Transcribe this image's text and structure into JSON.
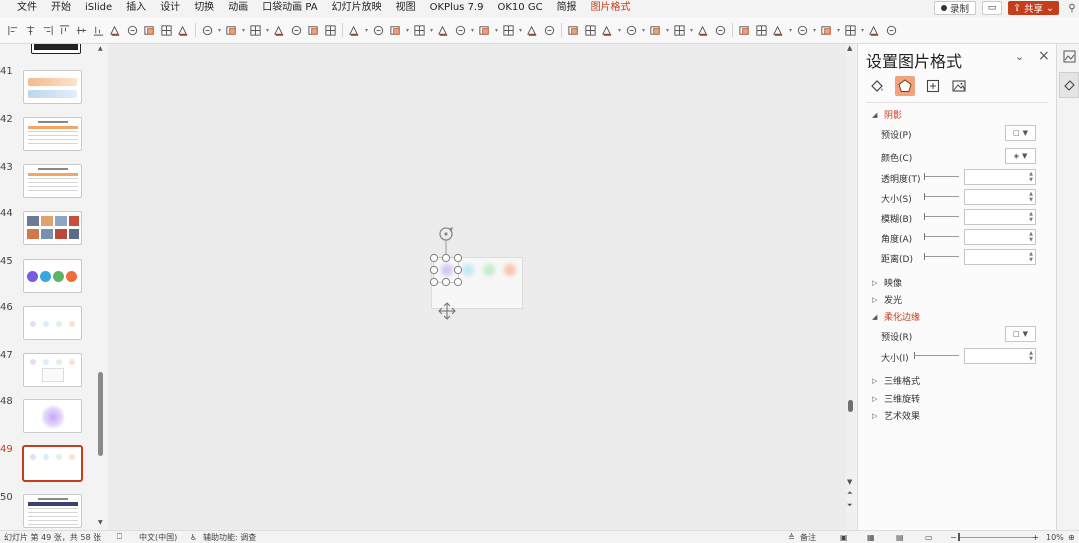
{
  "menu": {
    "tabs": [
      "文件",
      "开始",
      "iSlide",
      "插入",
      "设计",
      "切换",
      "动画",
      "口袋动画 PA",
      "幻灯片放映",
      "视图",
      "OKPlus 7.9",
      "OK10 GC",
      "简报",
      "图片格式"
    ],
    "active_tab": "图片格式",
    "record_label": "录制",
    "share_label": "共享"
  },
  "toolbar": {
    "icons": [
      "align-left-icon",
      "align-center-icon",
      "align-right-icon",
      "align-top-icon",
      "align-middle-icon",
      "align-bottom-icon",
      "distribute-horizontal-icon",
      "distribute-vertical-icon",
      "distribute-icon",
      "group-icon",
      "ungroup-icon",
      "rotate-icon",
      "shape-fill-icon",
      "shape-outline-icon",
      "bring-forward-icon",
      "send-backward-icon",
      "select-pane-icon",
      "arrange-icon",
      "fill-color-icon",
      "pen-icon",
      "font-color-icon",
      "text-color-icon",
      "highlighter-icon",
      "text-effect-icon",
      "character-spacing-icon",
      "change-case-icon",
      "paragraph-icon",
      "line-spacing-icon",
      "crop-icon",
      "shape-icon",
      "picture-effect-icon",
      "insert-picture-icon",
      "star-icon",
      "star-outline-icon",
      "star-empty-icon",
      "theme-icon",
      "eyedropper-icon",
      "picture-format-icon",
      "image-icon",
      "picture-style-icon",
      "picture-border-icon",
      "picture-layout-icon",
      "link-icon",
      "settings-icon"
    ]
  },
  "slides": {
    "numbers": [
      "41",
      "42",
      "43",
      "44",
      "45",
      "46",
      "47",
      "48",
      "49",
      "50"
    ],
    "current": "49"
  },
  "canvas": {
    "dot_colors": [
      "#c5b3f2",
      "#a9e4f4",
      "#b5e6b8",
      "#f5b08e"
    ]
  },
  "format_pane": {
    "title": "设置图片格式",
    "sections": {
      "shadow": "阴影",
      "reflection": "映像",
      "glow": "发光",
      "soft_edges": "柔化边缘",
      "three_d_format": "三维格式",
      "three_d_rotation": "三维旋转",
      "art_effects": "艺术效果"
    },
    "shadow_props": {
      "preset": "预设(P)",
      "color": "颜色(C)",
      "transparency": "透明度(T)",
      "size": "大小(S)",
      "blur": "模糊(B)",
      "angle": "角度(A)",
      "distance": "距离(D)"
    },
    "soft_edges_props": {
      "preset": "预设(R)",
      "size": "大小(I)"
    }
  },
  "statusbar": {
    "slide_info": "幻灯片 第 49 张，共 58 张",
    "language": "中文(中国)",
    "accessibility": "辅助功能: 调查",
    "notes": "备注",
    "zoom": "10%"
  }
}
